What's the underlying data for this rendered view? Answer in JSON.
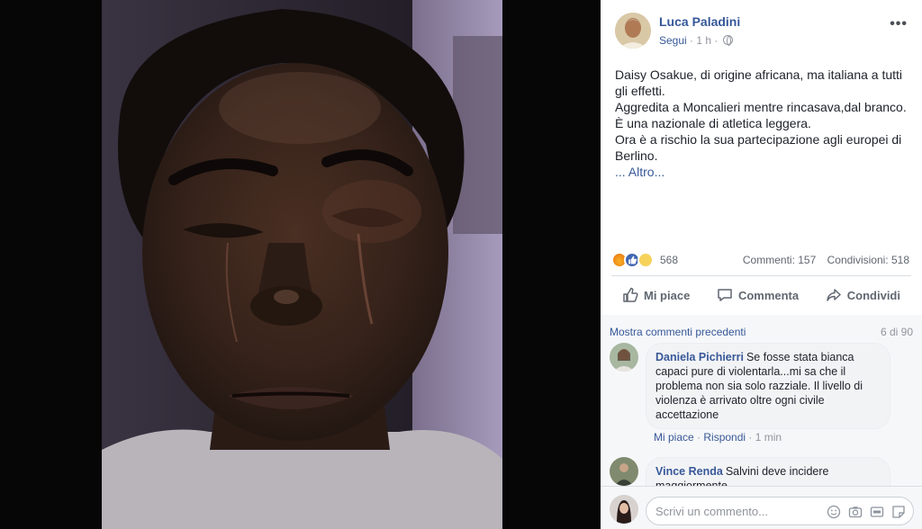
{
  "post": {
    "author": "Luca Paladini",
    "follow": "Segui",
    "separator": "·",
    "time": "1 h",
    "separator2": "·",
    "paragraphs": [
      "Daisy Osakue, di origine africana, ma italiana a tutti gli effetti.",
      "Aggredita a Moncalieri mentre rincasava,dal branco.",
      "È una nazionale di atletica leggera.",
      "Ora è a rischio la sua partecipazione agli europei di Berlino."
    ],
    "see_more": "... Altro..."
  },
  "reactions": {
    "icons": [
      "angry-icon",
      "like-icon",
      "sad-icon"
    ],
    "count": "568",
    "comments": "Commenti: 157",
    "shares": "Condivisioni: 518"
  },
  "actions": {
    "like": "Mi piace",
    "comment": "Commenta",
    "share": "Condividi"
  },
  "comments_section": {
    "previous": "Mostra commenti precedenti",
    "count": "6 di 90",
    "items": [
      {
        "name": "Daniela Pichierri",
        "text": "Se fosse stata bianca capaci pure di violentarla...mi sa che il problema non sia solo razziale. Il livello di violenza è arrivato oltre ogni civile accettazione",
        "like": "Mi piace",
        "reply": "Rispondi",
        "time": "1 min"
      },
      {
        "name": "Vince Renda",
        "text": "Salvini deve incidere maggiormente"
      }
    ]
  },
  "composer": {
    "placeholder": "Scrivi un commento...",
    "tools": [
      "emoji-icon",
      "camera-icon",
      "gif-icon",
      "sticker-icon"
    ]
  },
  "colors": {
    "link": "#365899",
    "text": "#1d2129",
    "muted": "#90949c",
    "like_blue": "#4267b2"
  }
}
